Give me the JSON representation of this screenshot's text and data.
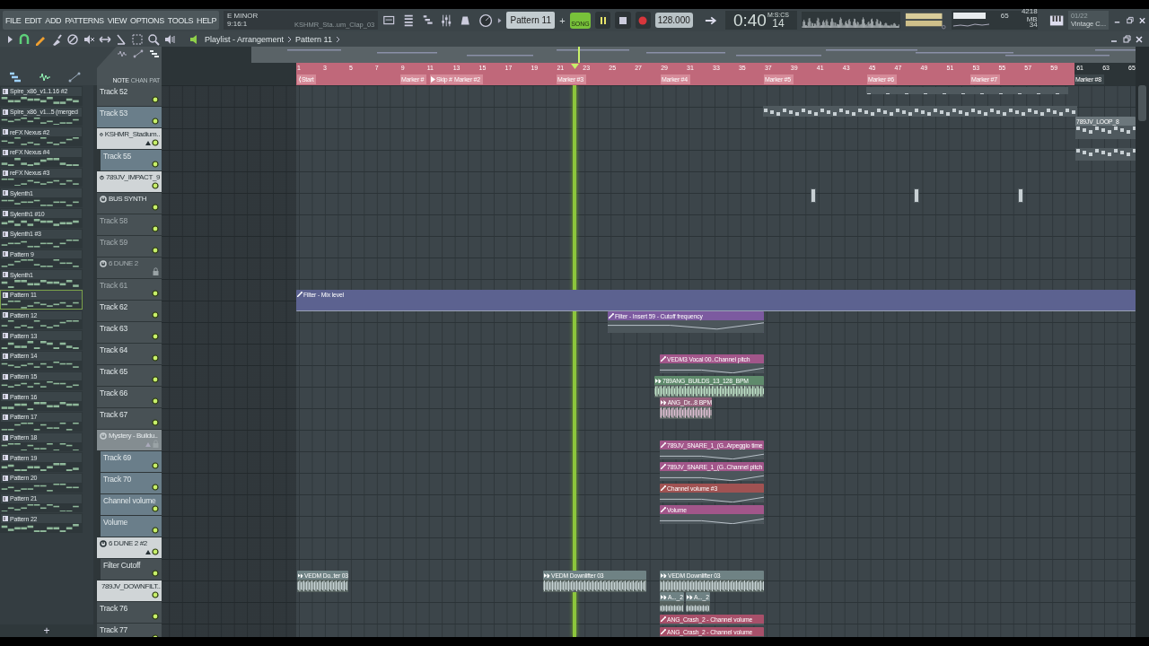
{
  "menu": [
    "FILE",
    "EDIT",
    "ADD",
    "PATTERNS",
    "VIEW",
    "OPTIONS",
    "TOOLS",
    "HELP"
  ],
  "hint": {
    "key": "E MINOR",
    "position": "9:16:1",
    "sample": "KSHMR_Sta..um_Clap_03"
  },
  "pattern_selector": {
    "value": "Pattern 11",
    "add": "+"
  },
  "transport": {
    "mode": "SONG",
    "playing": true,
    "tempo": "128.000",
    "time": "0:40",
    "time_cs": "14",
    "time_unit": "M:S:CS"
  },
  "monitor": {
    "cpu": "65",
    "memory": "4218 MB",
    "polyphony": "34"
  },
  "news": {
    "count": "01/22",
    "title": "Vintage C..."
  },
  "breadcrumb": [
    "Playlist - Arrangement",
    "Pattern 11"
  ],
  "picker": {
    "tabs": [
      {
        "label": "NOTE",
        "selected": true
      },
      {
        "label": "CHAN",
        "selected": false
      },
      {
        "label": "PAT",
        "selected": false
      }
    ],
    "add": "+",
    "patterns": [
      {
        "name": "Spire_x86_v1.1.16 #2",
        "selected": false
      },
      {
        "name": "Spire_x86_v1...5 (merged",
        "selected": false
      },
      {
        "name": "reFX Nexus #2",
        "selected": false
      },
      {
        "name": "reFX Nexus #4",
        "selected": false
      },
      {
        "name": "reFX Nexus #3",
        "selected": false
      },
      {
        "name": "Sylenth1",
        "selected": false
      },
      {
        "name": "Sylenth1 #10",
        "selected": false
      },
      {
        "name": "Sylenth1 #3",
        "selected": false
      },
      {
        "name": "Pattern 9",
        "selected": false
      },
      {
        "name": "Sylenth1",
        "selected": false
      },
      {
        "name": "Pattern 11",
        "selected": true
      },
      {
        "name": "Pattern 12",
        "selected": false
      },
      {
        "name": "Pattern 13",
        "selected": false
      },
      {
        "name": "Pattern 14",
        "selected": false
      },
      {
        "name": "Pattern 15",
        "selected": false
      },
      {
        "name": "Pattern 16",
        "selected": false
      },
      {
        "name": "Pattern 17",
        "selected": false
      },
      {
        "name": "Pattern 18",
        "selected": false
      },
      {
        "name": "Pattern 19",
        "selected": false
      },
      {
        "name": "Pattern 20",
        "selected": false
      },
      {
        "name": "Pattern 21",
        "selected": false
      },
      {
        "name": "Pattern 22",
        "selected": false
      }
    ]
  },
  "ruler": {
    "bars": [
      "1",
      "3",
      "5",
      "7",
      "9",
      "11",
      "13",
      "15",
      "17",
      "19",
      "21",
      "23",
      "25",
      "27",
      "29",
      "31",
      "33",
      "35",
      "37",
      "39",
      "41",
      "43",
      "45",
      "47",
      "49",
      "51",
      "53",
      "55",
      "57",
      "59",
      "61",
      "63",
      "65"
    ],
    "markers": [
      {
        "label": "Start",
        "kind": "start"
      },
      {
        "label": "Marker #",
        "kind": "marker"
      },
      {
        "label": "Skip #",
        "kind": "skip"
      },
      {
        "label": "Marker #2",
        "kind": "marker"
      },
      {
        "label": "Marker #3",
        "kind": "marker"
      },
      {
        "label": "Marker #4",
        "kind": "marker"
      },
      {
        "label": "Marker #5",
        "kind": "marker"
      },
      {
        "label": "Marker #6",
        "kind": "marker"
      },
      {
        "label": "Marker #7",
        "kind": "marker"
      },
      {
        "label": "Marker #8",
        "kind": "marker"
      }
    ]
  },
  "tracks": [
    {
      "name": "Track 52",
      "kind": "track",
      "highlighted": false,
      "dimmed": false
    },
    {
      "name": "Track 53",
      "kind": "track",
      "highlighted": true,
      "dimmed": false
    },
    {
      "name": "KSHMR_Stadium..",
      "kind": "folder",
      "highlighted": true,
      "dimmed": false,
      "locked": false,
      "children": [
        {
          "name": "Track 55",
          "kind": "track",
          "highlighted": true,
          "dimmed": false
        }
      ]
    },
    {
      "name": "789JV_IMPACT_9",
      "kind": "folder",
      "highlighted": true,
      "dimmed": false,
      "locked": false
    },
    {
      "name": "BUS SYNTH",
      "kind": "folder",
      "highlighted": false,
      "dimmed": false,
      "locked": false
    },
    {
      "name": "Track 58",
      "kind": "track",
      "highlighted": false,
      "dimmed": true
    },
    {
      "name": "Track 59",
      "kind": "track",
      "highlighted": false,
      "dimmed": true
    },
    {
      "name": "6 DUNE 2",
      "kind": "folder",
      "highlighted": false,
      "dimmed": true,
      "locked": true
    },
    {
      "name": "Track 61",
      "kind": "track",
      "highlighted": false,
      "dimmed": true
    },
    {
      "name": "Track 62",
      "kind": "track",
      "highlighted": false,
      "dimmed": false
    },
    {
      "name": "Track 63",
      "kind": "track",
      "highlighted": false,
      "dimmed": false
    },
    {
      "name": "Track 64",
      "kind": "track",
      "highlighted": false,
      "dimmed": false
    },
    {
      "name": "Track 65",
      "kind": "track",
      "highlighted": false,
      "dimmed": false
    },
    {
      "name": "Track 66",
      "kind": "track",
      "highlighted": false,
      "dimmed": false
    },
    {
      "name": "Track 67",
      "kind": "track",
      "highlighted": false,
      "dimmed": false
    },
    {
      "name": "Mystery - Buildu..",
      "kind": "folder",
      "highlighted": true,
      "dimmed": true,
      "locked": true,
      "children": [
        {
          "name": "Track 69",
          "kind": "track",
          "highlighted": true,
          "dimmed": false
        },
        {
          "name": "Track 70",
          "kind": "track",
          "highlighted": true,
          "dimmed": false
        },
        {
          "name": "Channel volume",
          "kind": "track",
          "highlighted": true,
          "dimmed": false
        },
        {
          "name": "Volume",
          "kind": "track",
          "highlighted": true,
          "dimmed": false
        }
      ]
    },
    {
      "name": "6 DUNE 2 #2",
      "kind": "folder",
      "highlighted": true,
      "dimmed": false,
      "locked": false,
      "children": [
        {
          "name": "Filter Cutoff",
          "kind": "track",
          "highlighted": false,
          "dimmed": false
        }
      ]
    },
    {
      "name": "789JV_DOWNFILT..",
      "kind": "folder",
      "highlighted": true,
      "dimmed": false,
      "locked": false
    },
    {
      "name": "Track 76",
      "kind": "track",
      "highlighted": false,
      "dimmed": false
    },
    {
      "name": "Track 77",
      "kind": "track",
      "highlighted": false,
      "dimmed": false
    }
  ],
  "clips": [
    {
      "label": "Filter - Mix level",
      "kind": "automation",
      "color": "#5c6290"
    },
    {
      "label": "Filter - Insert 59 - Cutoff frequency",
      "kind": "automation",
      "color": "#7c5aa0"
    },
    {
      "label": "VEDM3 Vocal 00..Channel pitch",
      "kind": "automation",
      "color": "#a2568a"
    },
    {
      "label": "789ANG_BUILDS_13_128_BPM",
      "kind": "audio",
      "color": "#5f8a6c"
    },
    {
      "label": "ANG_Dr...8 BPM",
      "kind": "audio",
      "color": "#98627e"
    },
    {
      "label": "789JV_SNARE_1_(G..Arpeggio time",
      "kind": "automation",
      "color": "#a2568a"
    },
    {
      "label": "789JV_SNARE_1_(G..Channel pitch",
      "kind": "automation",
      "color": "#a2568a"
    },
    {
      "label": "Channel volume #3",
      "kind": "automation",
      "color": "#a05252"
    },
    {
      "label": "Volume",
      "kind": "automation",
      "color": "#a2568a"
    },
    {
      "label": "VEDM Do..ter 03",
      "kind": "audio",
      "color": "#6f8284"
    },
    {
      "label": "VEDM Downlifter 03",
      "kind": "audio",
      "color": "#6f8284"
    },
    {
      "label": "VEDM Downlifter 03",
      "kind": "audio",
      "color": "#6f8284"
    },
    {
      "label": "A..._2",
      "kind": "audio",
      "color": "#6f8284"
    },
    {
      "label": "A..._2",
      "kind": "audio",
      "color": "#6f8284"
    },
    {
      "label": "ANG_Crash_2 - Channel volume",
      "kind": "automation",
      "color": "#a8506a"
    },
    {
      "label": "ANG_Crash_2 - Channel volume",
      "kind": "automation",
      "color": "#a8506a"
    },
    {
      "label": "789JV_LOOP_8",
      "kind": "pattern",
      "color": "#6c777c"
    },
    {
      "kind": "pattern",
      "color": "#5c666b"
    },
    {
      "kind": "pattern",
      "color": "#5c666b"
    },
    {
      "kind": "pattern",
      "color": "#5c666b"
    },
    {
      "kind": "pattern",
      "color": "#5c666b"
    },
    {
      "kind": "pattern",
      "color": "#5c666b"
    },
    {
      "kind": "pattern",
      "color": "#5c666b"
    }
  ]
}
